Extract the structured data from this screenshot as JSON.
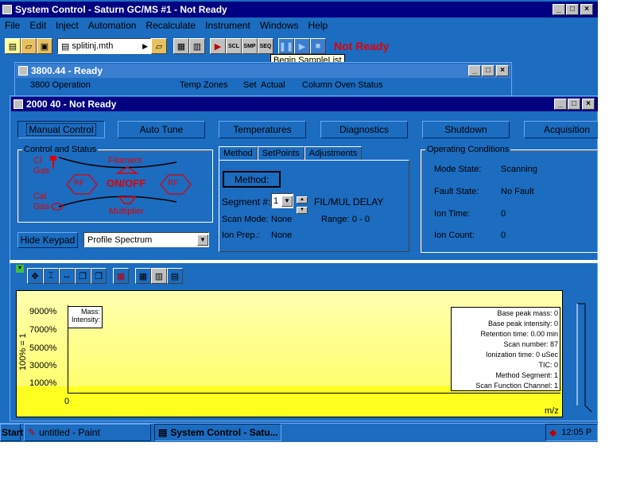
{
  "main_window": {
    "title": "System Control - Saturn GC/MS #1 - Not Ready",
    "menu": [
      "File",
      "Edit",
      "Inject",
      "Automation",
      "Recalculate",
      "Instrument",
      "Windows",
      "Help"
    ],
    "method_file": "splitinj.mth",
    "toolbar_icons": [
      "new-icon",
      "open-icon",
      "save-icon",
      "file-icon",
      "open-folder-icon",
      "report-icon",
      "view-icon",
      "begin-icon",
      "sample-list-icon",
      "single-sample-icon",
      "sequence-icon",
      "pause-icon",
      "play-icon",
      "stop-icon"
    ],
    "status": "Not Ready",
    "tooltip": "Begin SampleList"
  },
  "win3800": {
    "title": "3800.44 - Ready",
    "headers": [
      "3800 Operation",
      "Temp Zones",
      "Set",
      "Actual",
      "Column Oven Status"
    ]
  },
  "win2000": {
    "title": "2000 40 - Not Ready",
    "buttons": [
      "Manual Control",
      "Auto Tune",
      "Temperatures",
      "Diagnostics",
      "Shutdown",
      "Acquisition"
    ],
    "control_status": {
      "label": "Control and Status",
      "ci": "CI",
      "gas": "Gas",
      "cal": "Cal",
      "gas2": "Gas",
      "filament": "Filament",
      "onoff": "ON/OFF",
      "rf_left": "RF",
      "rf_right": "RF",
      "multiplier": "Multiplier"
    },
    "hide_keypad": "Hide Keypad",
    "spectrum_select": "Profile Spectrum",
    "tabs": [
      "Method",
      "SetPoints",
      "Adjustments"
    ],
    "method_button": "Method:",
    "segment_label": "Segment #:",
    "segment_value": "1",
    "segment_desc": "FIL/MUL DELAY",
    "scan_mode_label": "Scan Mode:",
    "scan_mode_value": "None",
    "range_label": "Range:",
    "range_value": "0 - 0",
    "ion_prep_label": "Ion Prep.:",
    "ion_prep_value": "None",
    "operating": {
      "label": "Operating Conditions",
      "rows": [
        {
          "label": "Mode State:",
          "value": "Scanning"
        },
        {
          "label": "Fault State:",
          "value": "No Fault"
        },
        {
          "label": "Ion Time:",
          "value": "0"
        },
        {
          "label": "Ion Count:",
          "value": "0"
        }
      ]
    }
  },
  "spectrum": {
    "y_axis_label": "100% = 1",
    "y_ticks": [
      "9000%",
      "7000%",
      "5000%",
      "3000%",
      "1000%"
    ],
    "x_tick": "0",
    "x_label": "m/z",
    "mass_label": "Mass:",
    "intensity_label": "Intensity:",
    "info": [
      "Base peak mass: 0",
      "Base peak intensity: 0",
      "Retention time: 0.00 min",
      "Scan number: 87",
      "Ionization time: 0 uSec",
      "TIC: 0",
      "Method Segment: 1",
      "Scan Function Channel: 1"
    ]
  },
  "taskbar": {
    "start": "Start",
    "items": [
      "untitled - Paint",
      "System Control - Satu..."
    ],
    "clock": "12:05 P"
  },
  "colors": {
    "titlebar": "#000080",
    "panel": "#1c6cc0",
    "plot": "#ffff80",
    "alert": "#e00000"
  }
}
